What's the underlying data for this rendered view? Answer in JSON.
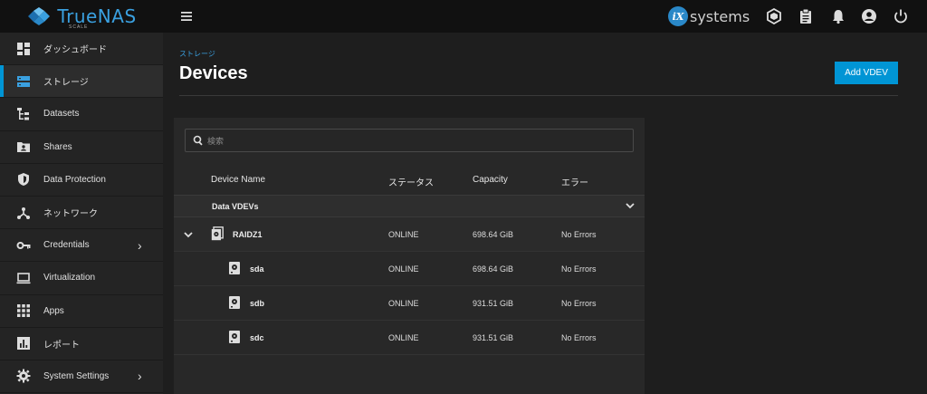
{
  "header": {
    "logo_text": "TrueNAS",
    "logo_sub": "SCALE",
    "ix_badge": "iX",
    "ix_text": "systems",
    "icons": [
      "menu-icon",
      "truecommand-icon",
      "clipboard-icon",
      "bell-icon",
      "account-icon",
      "power-icon"
    ]
  },
  "sidebar": {
    "items": [
      {
        "label": "ダッシュボード",
        "icon": "dashboard-icon"
      },
      {
        "label": "ストレージ",
        "icon": "storage-icon"
      },
      {
        "label": "Datasets",
        "icon": "datasets-icon"
      },
      {
        "label": "Shares",
        "icon": "shares-icon"
      },
      {
        "label": "Data Protection",
        "icon": "shield-icon"
      },
      {
        "label": "ネットワーク",
        "icon": "network-icon"
      },
      {
        "label": "Credentials",
        "icon": "key-icon",
        "chevron": "›"
      },
      {
        "label": "Virtualization",
        "icon": "laptop-icon"
      },
      {
        "label": "Apps",
        "icon": "apps-grid-icon"
      },
      {
        "label": "レポート",
        "icon": "chart-icon"
      },
      {
        "label": "System Settings",
        "icon": "gear-icon",
        "chevron": "›"
      }
    ],
    "active_index": 1
  },
  "page": {
    "breadcrumb": "ストレージ",
    "title": "Devices",
    "add_button": "Add VDEV"
  },
  "table": {
    "search_placeholder": "検索",
    "columns": [
      "Device Name",
      "ステータス",
      "Capacity",
      "エラー"
    ],
    "group_label": "Data VDEVs",
    "rows": [
      {
        "name": "RAIDZ1",
        "status": "ONLINE",
        "capacity": "698.64 GiB",
        "errors": "No Errors"
      },
      {
        "name": "sda",
        "status": "ONLINE",
        "capacity": "698.64 GiB",
        "errors": "No Errors"
      },
      {
        "name": "sdb",
        "status": "ONLINE",
        "capacity": "931.51 GiB",
        "errors": "No Errors"
      },
      {
        "name": "sdc",
        "status": "ONLINE",
        "capacity": "931.51 GiB",
        "errors": "No Errors"
      }
    ]
  },
  "colors": {
    "accent": "#0095d5",
    "topbar": "#111111",
    "sidebar": "#242424",
    "background": "#1e1e1e"
  }
}
